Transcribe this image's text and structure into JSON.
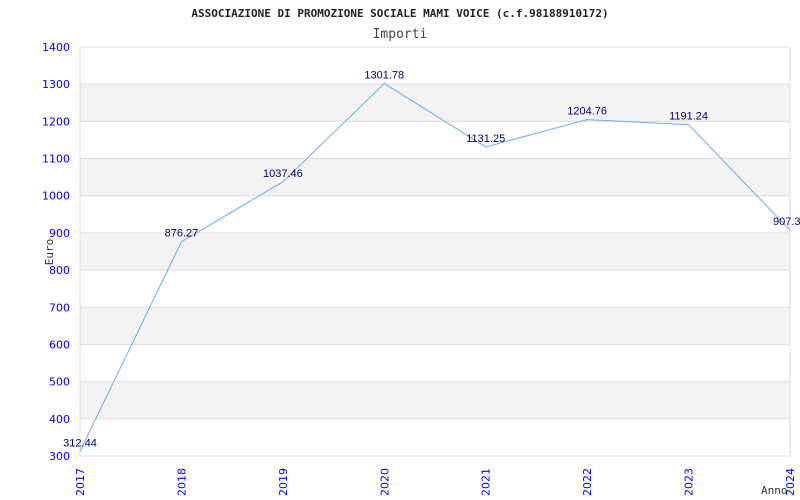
{
  "chart_data": {
    "type": "line",
    "title": "ASSOCIAZIONE DI PROMOZIONE SOCIALE MAMI VOICE (c.f.98188910172)",
    "subtitle": "Importi",
    "xlabel": "Anno",
    "ylabel": "Euro",
    "categories": [
      "2017",
      "2018",
      "2019",
      "2020",
      "2021",
      "2022",
      "2023",
      "2024"
    ],
    "values": [
      312.44,
      876.27,
      1037.46,
      1301.78,
      1131.25,
      1204.76,
      1191.24,
      907.3
    ],
    "data_labels": [
      "312.44",
      "876.27",
      "1037.46",
      "1301.78",
      "1131.25",
      "1204.76",
      "1191.24",
      "907.3"
    ],
    "ylim": [
      300,
      1400
    ],
    "yticks": [
      300,
      400,
      500,
      600,
      700,
      800,
      900,
      1000,
      1100,
      1200,
      1300,
      1400
    ],
    "grid": true,
    "line_color": "#6aaaf0",
    "band_color": "#f3f3f3",
    "tick_color": "#0000ff",
    "label_color": "#000080"
  }
}
